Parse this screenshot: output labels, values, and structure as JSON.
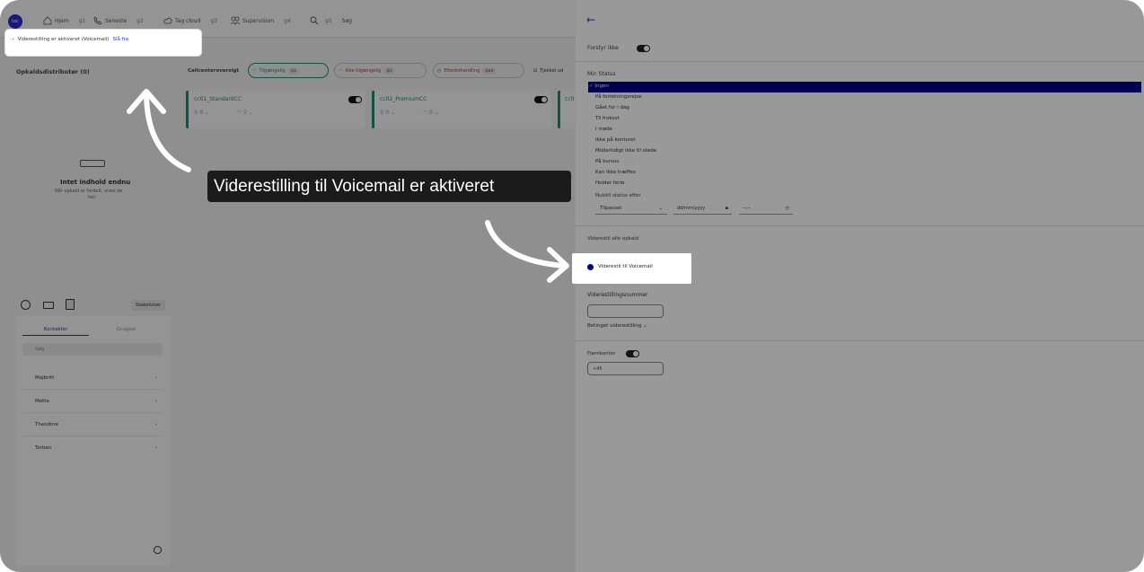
{
  "nav": {
    "avatar": "toc",
    "items": [
      {
        "label": "Hjem",
        "shortcut": "g1"
      },
      {
        "label": "Seneste",
        "shortcut": "g2"
      },
      {
        "label": "Tag cloud",
        "shortcut": "g3"
      },
      {
        "label": "Supervision",
        "shortcut": "g4"
      },
      {
        "label": "Søg",
        "shortcut": "g5"
      }
    ]
  },
  "banner": {
    "text": "Viderestilling er aktiveret (Voicemail)",
    "action": "Slå fra"
  },
  "left": {
    "title": "Opkaldsdistributør (0)",
    "empty_title": "Intet indhold endnu",
    "empty_text_line1": "Når opkald er fordelt, vises de",
    "empty_text_line2": "her.",
    "tabs_right": "Stabelviser",
    "tab_contacts": "Kontakter",
    "tab_groups": "Grupper",
    "search_placeholder": "Søg",
    "contacts": [
      "Majbritt",
      "Mette",
      "Theodore",
      "Torben"
    ]
  },
  "center": {
    "title": "Callcenteroversigt",
    "queue_buttons": [
      {
        "label": "Tilgængelig",
        "count": "qa"
      },
      {
        "label": "Ikke tilgængelig",
        "count": "qu"
      },
      {
        "label": "Efterbehandling",
        "count": "qaa"
      },
      {
        "label": "Tjekket ud",
        "count": ""
      }
    ],
    "cards": [
      {
        "name": "cc01_StandardCC",
        "s1": "0",
        "s2": "1"
      },
      {
        "name": "cc02_PremiumCC",
        "s1": "0",
        "s2": "0"
      },
      {
        "name": "cc0",
        "s1": "",
        "s2": ""
      }
    ]
  },
  "callout": "Viderestilling til Voicemail er aktiveret",
  "panel": {
    "dnd_label": "Forstyr ikke",
    "status_heading": "Min Status",
    "statuses": [
      "Ingen",
      "På forretningsrejse",
      "Gået for i dag",
      "Til frokost",
      "I møde",
      "Ikke på kontoret",
      "Midlertidigt ikke til stede",
      "På kursus",
      "Kan ikke træffes",
      "Holder ferie"
    ],
    "reset_label": "Nulstil status efter",
    "reset_value": "Tilpasset",
    "date_placeholder": "dd/mm/yyyy",
    "time_placeholder": "--:--",
    "forward_heading": "Viderestil alle opkald",
    "voicemail_option": "Viderestil til Voicemail",
    "forward_number_heading": "Viderestillingsnummer",
    "conditional_label": "Betinget viderestilling",
    "remote_label": "Fjernkontor",
    "remote_value": "+45",
    "accent_color": "#00008b"
  }
}
